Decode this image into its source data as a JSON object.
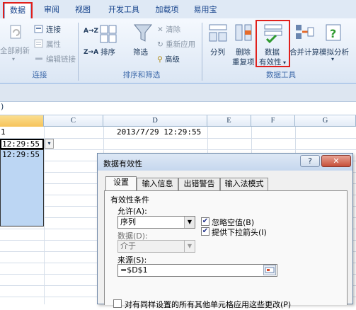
{
  "tabs": [
    "数据",
    "审阅",
    "视图",
    "开发工具",
    "加载项",
    "易用宝"
  ],
  "ribbon": {
    "refresh_all": "全部刷新",
    "connections": "连接",
    "properties": "属性",
    "edit_links": "编辑链接",
    "group_connections": "连接",
    "sort_asc_icon": "A→Z",
    "sort_desc_icon": "Z→A",
    "sort": "排序",
    "filter": "筛选",
    "clear": "清除",
    "reapply": "重新应用",
    "advanced": "高级",
    "group_sort_filter": "排序和筛选",
    "text_to_columns": "分列",
    "remove_dup_1": "删除",
    "remove_dup_2": "重复项",
    "validation_1": "数据",
    "validation_2": "有效性",
    "consolidate": "合并计算",
    "what_if": "模拟分析",
    "group_data_tools": "数据工具"
  },
  "sheet": {
    "formula_text": ")",
    "columns": [
      "C",
      "D",
      "E",
      "F",
      "G"
    ],
    "d1_value": "2013/7/29 12:29:55",
    "a1_value": "1",
    "a2_value": "12:29:55",
    "a3_value": "12:29:55"
  },
  "dialog": {
    "title": "数据有效性",
    "help": "?",
    "close": "✕",
    "tabs": [
      "设置",
      "输入信息",
      "出错警告",
      "输入法模式"
    ],
    "section": "有效性条件",
    "allow_label": "允许(A):",
    "allow_value": "序列",
    "ignore_blank": "忽略空值(B)",
    "dropdown": "提供下拉箭头(I)",
    "data_label": "数据(D):",
    "data_value": "介于",
    "source_label": "来源(S):",
    "source_value": "=$D$1",
    "apply_all": "对有同样设置的所有其他单元格应用这些更改(P)"
  },
  "colors": {
    "highlight": "#e0201c",
    "selected_cell": "#bcd6f3",
    "ribbon_bg": "#dbe6f4"
  }
}
